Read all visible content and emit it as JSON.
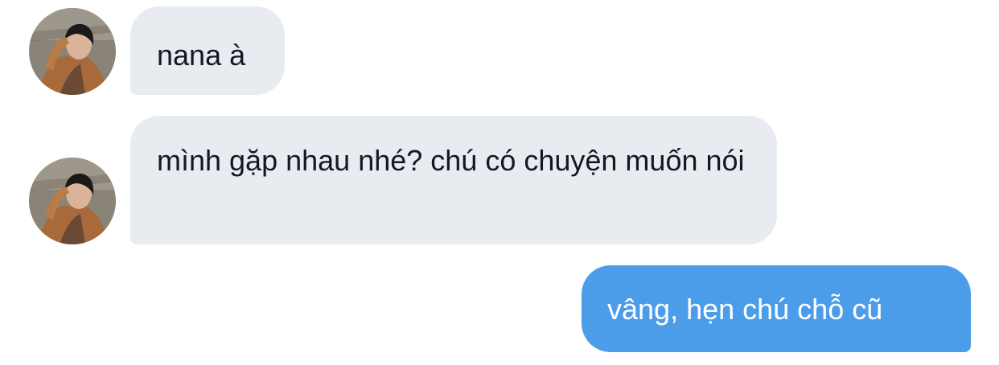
{
  "conversation": {
    "messages": [
      {
        "sender": "other",
        "text": "nana à",
        "avatar": "profile-photo"
      },
      {
        "sender": "other",
        "text": "mình gặp nhau nhé? chú có chuyện muốn nói",
        "avatar": "profile-photo"
      },
      {
        "sender": "me",
        "text": "vâng, hẹn chú chỗ cũ"
      }
    ]
  },
  "colors": {
    "incoming_bubble": "#e8ebf0",
    "outgoing_bubble": "#4c9de9",
    "incoming_text": "#141823",
    "outgoing_text": "#ffffff"
  }
}
